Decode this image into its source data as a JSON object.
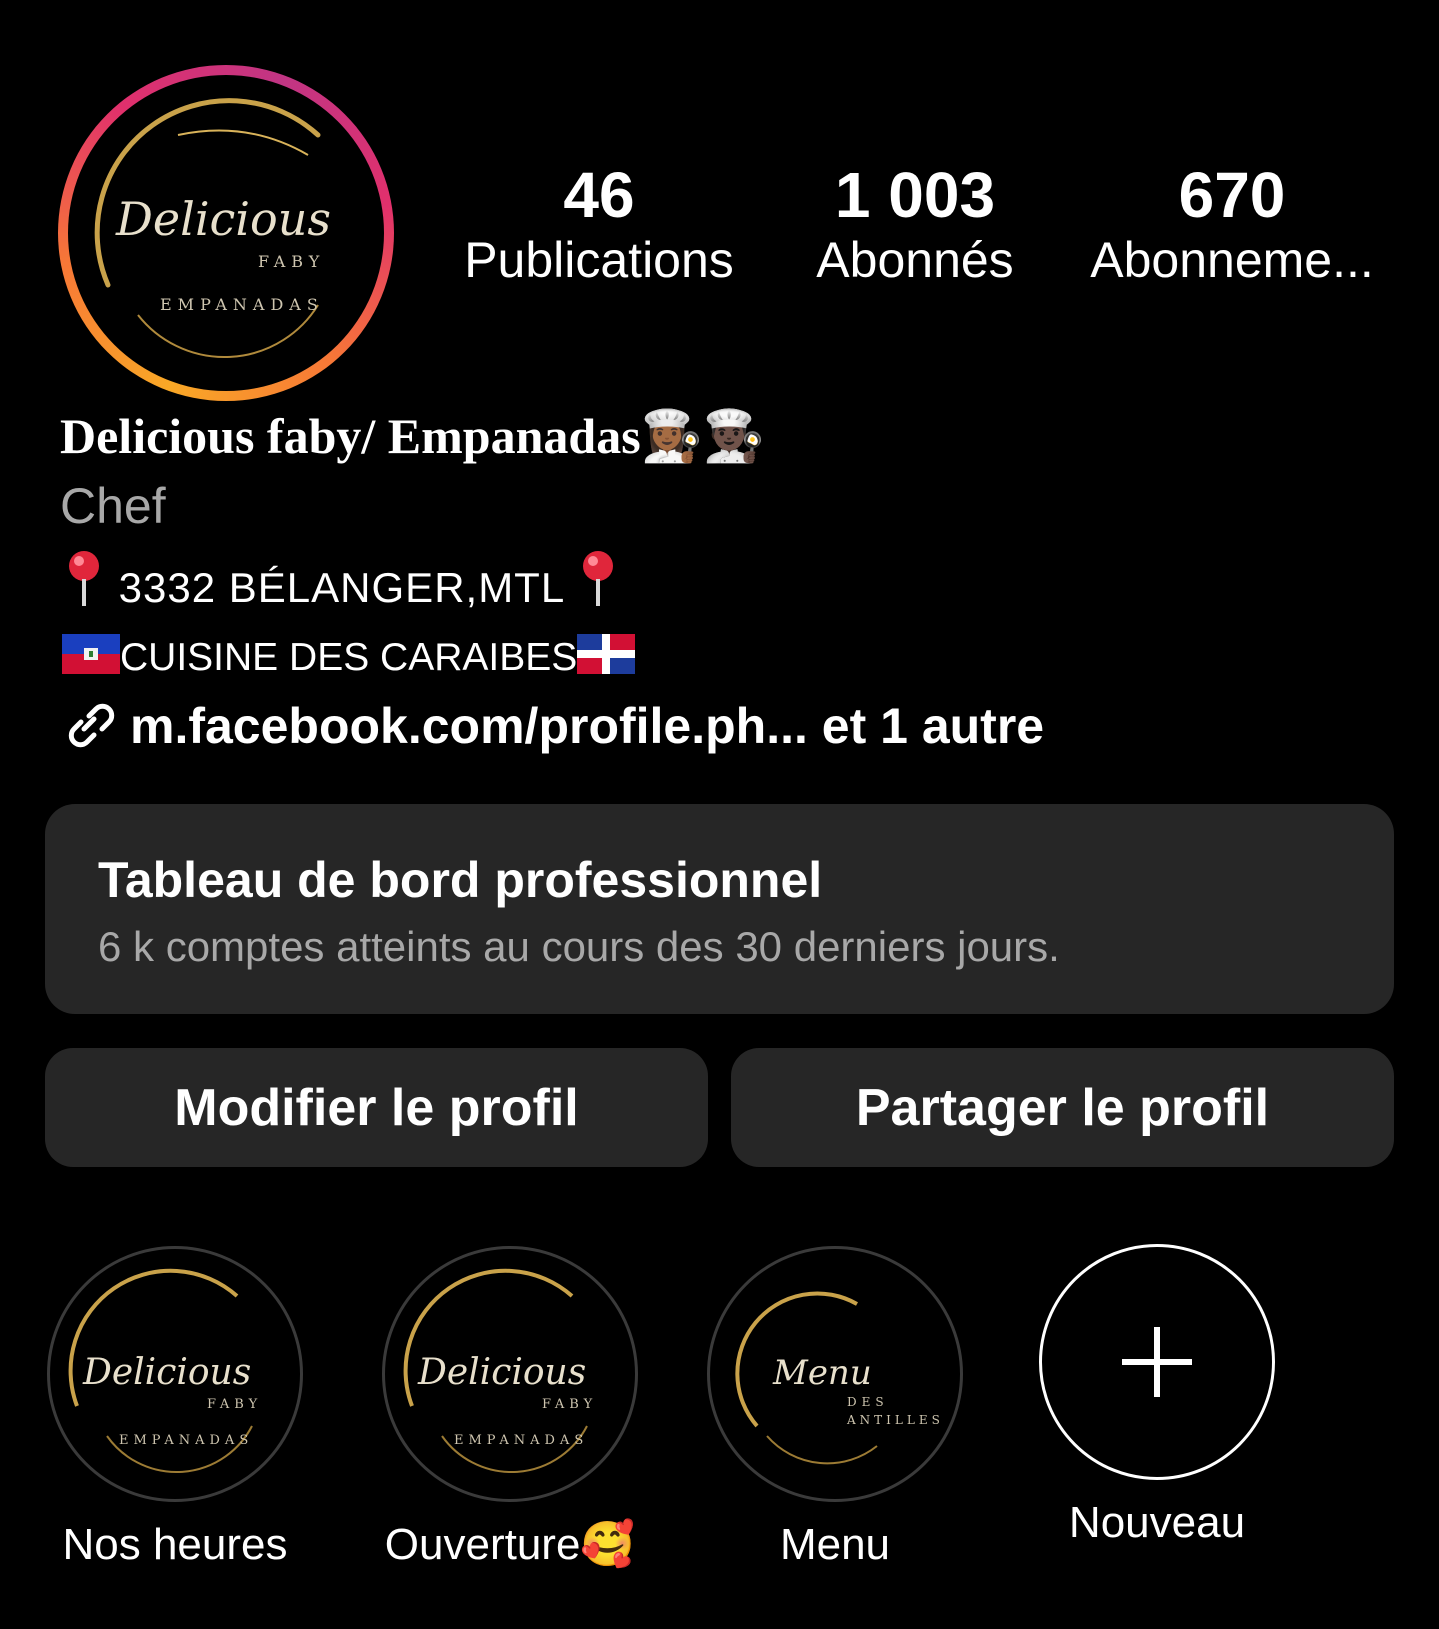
{
  "profile": {
    "avatar_logo": {
      "script": "Delicious",
      "small": "FABY",
      "bottom": "EMPANADAS"
    },
    "name": "Delicious faby/ Empanadas👩🏾‍🍳👨🏿‍🍳",
    "category": "Chef",
    "address": "3332 BÉLANGER,MTL",
    "cuisine": "CUISINE DES CARAIBES",
    "link_text": "m.facebook.com/profile.ph... et 1 autre"
  },
  "stats": [
    {
      "value": "46",
      "label": "Publications"
    },
    {
      "value": "1 003",
      "label": "Abonnés"
    },
    {
      "value": "670",
      "label": "Abonneme..."
    }
  ],
  "dashboard": {
    "title": "Tableau de bord professionnel",
    "subtitle": "6 k comptes atteints au cours des 30 derniers jours."
  },
  "buttons": {
    "edit": "Modifier le profil",
    "share": "Partager le profil"
  },
  "highlights": [
    {
      "label": "Nos heures",
      "logo_script": "Delicious",
      "logo_small": "FABY",
      "logo_bottom": "EMPANADAS"
    },
    {
      "label": "Ouverture🥰",
      "logo_script": "Delicious",
      "logo_small": "FABY",
      "logo_bottom": "EMPANADAS"
    },
    {
      "label": "Menu",
      "logo_script": "Menu",
      "logo_small": "DES",
      "logo_bottom": "ANTILLES"
    },
    {
      "label": "Nouveau"
    }
  ],
  "icons": {
    "pin": "pin-icon",
    "link": "link-icon",
    "plus": "plus-icon",
    "haiti_flag": "haiti-flag-icon",
    "dominican_flag": "dominican-flag-icon"
  },
  "colors": {
    "background": "#000000",
    "card": "#262626",
    "secondary_text": "#a8a8a8",
    "gold": "#c9a24a"
  }
}
